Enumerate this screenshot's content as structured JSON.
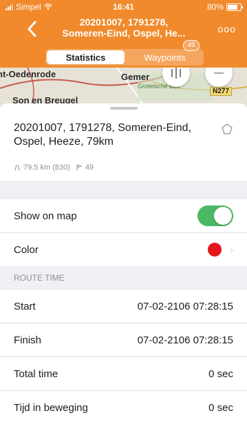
{
  "status_bar": {
    "carrier": "Simpel",
    "time": "16:41",
    "battery": "80%"
  },
  "nav": {
    "title_line1": "20201007, 1791278,",
    "title_line2": "Someren-Eind, Ospel, He...",
    "more_label": "ooo"
  },
  "tabs": [
    {
      "label": "Statistics",
      "active": true
    },
    {
      "label": "Waypoints",
      "active": false,
      "badge": "49"
    }
  ],
  "map": {
    "labels": [
      "nt-Oedenrode",
      "Gemer",
      "Son en Breugel"
    ],
    "italic_label": "Grotelsche Bos",
    "road": "N277"
  },
  "route": {
    "name": "20201007, 1791278, Someren-Eind, Ospel, Heeze, 79km",
    "distance": "79.5 km (830)",
    "waypoints": "49"
  },
  "settings": {
    "show_on_map_label": "Show on map",
    "show_on_map_on": true,
    "color_label": "Color",
    "color_value": "#e5141d"
  },
  "route_time": {
    "header": "ROUTE TIME",
    "rows": [
      {
        "label": "Start",
        "value": "07-02-2106 07:28:15"
      },
      {
        "label": "Finish",
        "value": "07-02-2106 07:28:15"
      },
      {
        "label": "Total time",
        "value": "0 sec"
      },
      {
        "label": "Tijd in beweging",
        "value": "0 sec"
      }
    ]
  },
  "colors": {
    "accent": "#f08a2c",
    "toggle_on": "#4cb865"
  }
}
